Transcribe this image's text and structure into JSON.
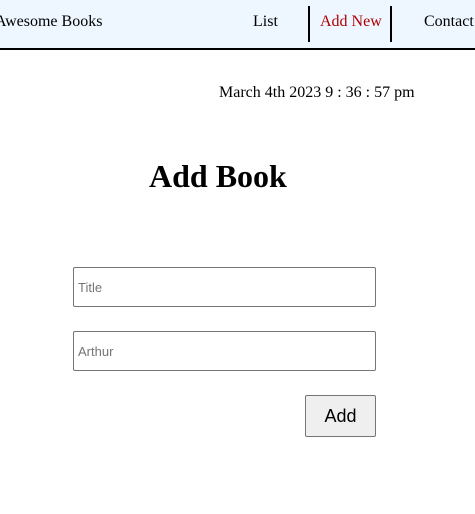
{
  "navbar": {
    "brand": "Awesome Books",
    "links": [
      {
        "label": "List",
        "active": false
      },
      {
        "label": "Add New",
        "active": true
      },
      {
        "label": "Contact",
        "active": false
      }
    ],
    "active_color": "#b00000",
    "background_color": "#eef6ff"
  },
  "datetime": "March 4th 2023 9 : 36 : 57 pm",
  "main": {
    "title": "Add Book",
    "form": {
      "title_placeholder": "Title",
      "title_value": "",
      "author_placeholder": "Arthur",
      "author_value": "",
      "submit_label": "Add"
    }
  }
}
